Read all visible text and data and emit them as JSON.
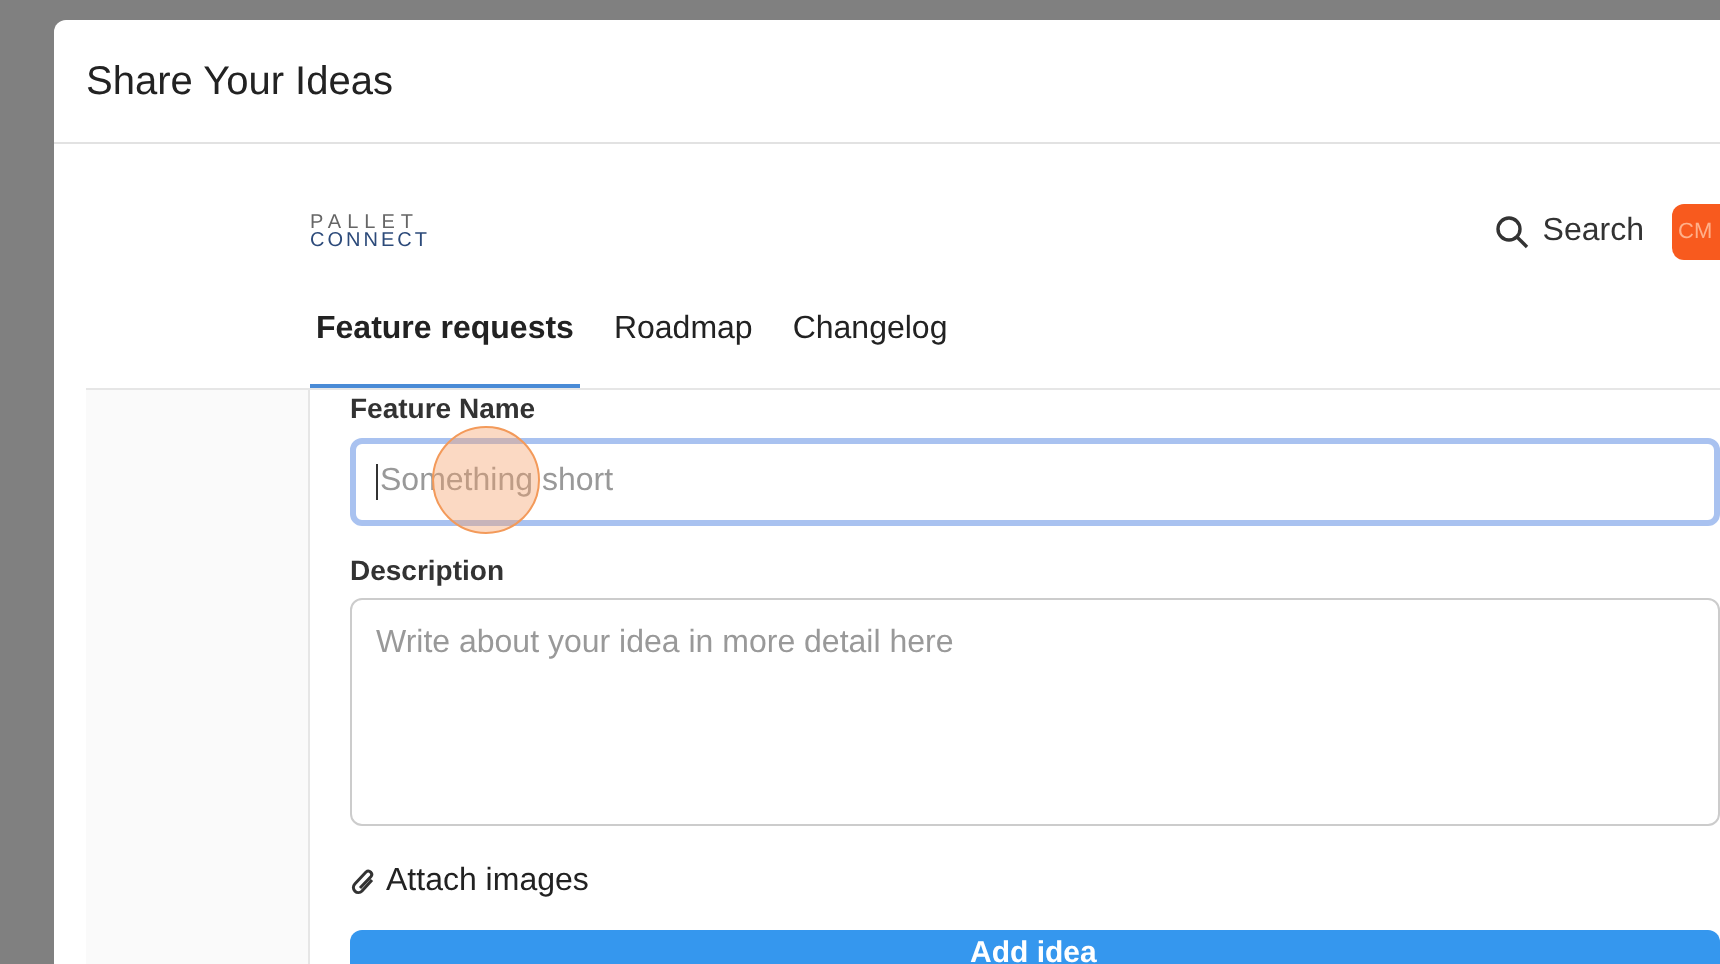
{
  "dialog": {
    "title": "Share Your Ideas"
  },
  "header": {
    "logo_top": "PALLET",
    "logo_bottom": "CONNECT",
    "search": "Search",
    "avatar": "CM"
  },
  "tabs": [
    {
      "label": "Feature requests",
      "selected": true
    },
    {
      "label": "Roadmap",
      "selected": false
    },
    {
      "label": "Changelog",
      "selected": false
    }
  ],
  "form": {
    "name_label": "Feature Name",
    "name_placeholder": "Something short",
    "name_focused": true,
    "description_label": "Description",
    "description_placeholder": "Write about your idea in more detail here",
    "attach": "Attach images",
    "submit": "Add idea"
  }
}
